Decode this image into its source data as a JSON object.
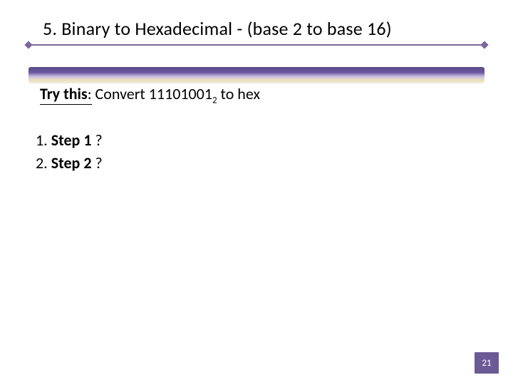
{
  "title": "5. Binary to Hexadecimal - (base 2 to base 16)",
  "prompt": {
    "lead": "Try this",
    "colon": ":",
    "text_before_num": "  Convert ",
    "binary": "11101001",
    "base": "2",
    "text_after_num": " to hex"
  },
  "steps": [
    {
      "num": "1.",
      "bold": "Step 1",
      "tail": " ?"
    },
    {
      "num": "2.",
      "bold": "Step 2",
      "tail": " ?"
    }
  ],
  "page_number": "21"
}
